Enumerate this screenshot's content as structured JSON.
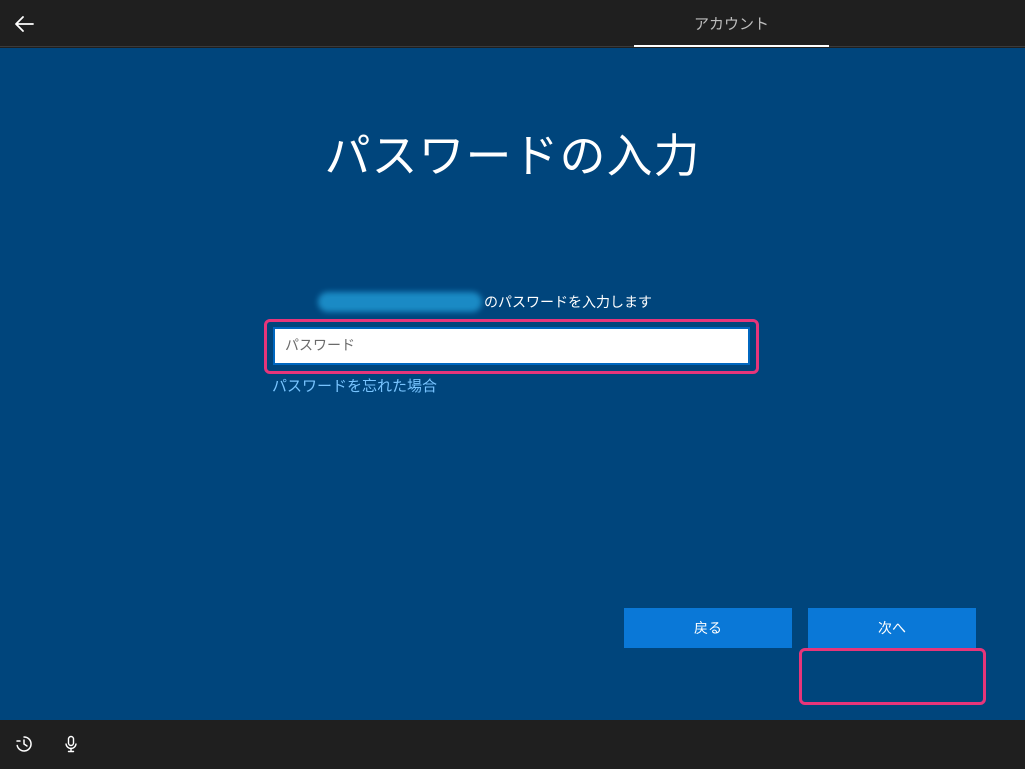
{
  "topbar": {
    "tab_label": "アカウント"
  },
  "page": {
    "title": "パスワードの入力",
    "prompt": "のパスワードを入力します",
    "password_placeholder": "パスワード",
    "forgot_link": "パスワードを忘れた場合"
  },
  "buttons": {
    "back_label": "戻る",
    "next_label": "次へ"
  },
  "icons": {
    "back": "back-arrow-icon",
    "ease": "ease-of-access-icon",
    "mic": "microphone-icon"
  },
  "colors": {
    "background": "#00457c",
    "bar": "#1f1f1f",
    "button": "#0a78d7",
    "link": "#78c4ff",
    "highlight": "#e7357a"
  }
}
